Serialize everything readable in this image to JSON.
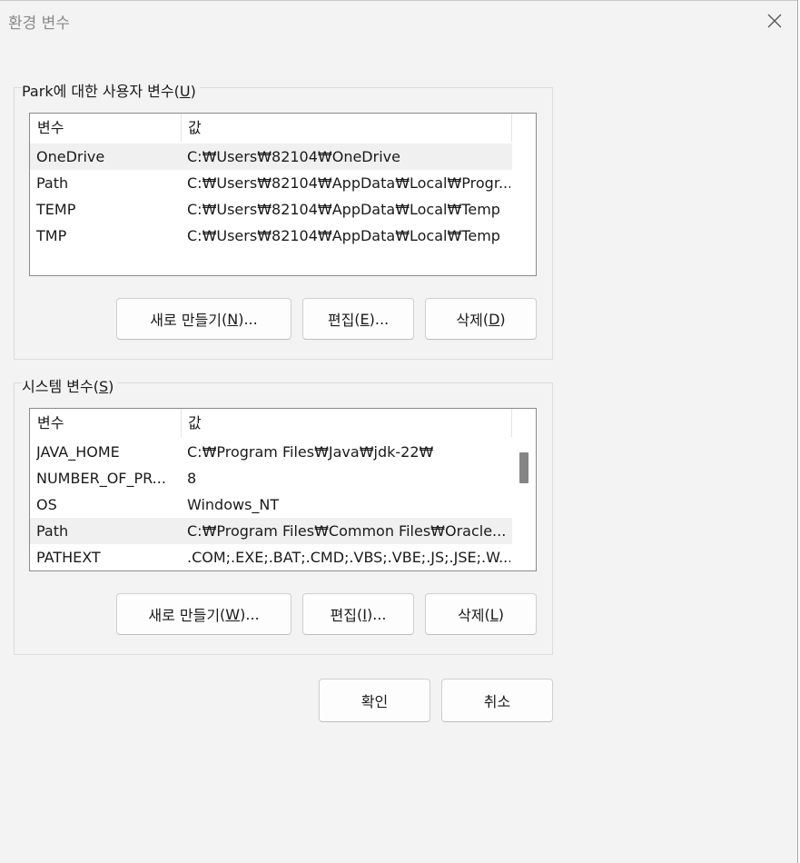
{
  "window": {
    "title": "환경 변수",
    "close_icon": "close-icon"
  },
  "user_vars": {
    "label": "Park에 대한 사용자 변수",
    "label_accel": "U",
    "columns": [
      "변수",
      "값"
    ],
    "rows": [
      {
        "name": "OneDrive",
        "value": "C:₩Users₩82104₩OneDrive",
        "selected": true
      },
      {
        "name": "Path",
        "value": "C:₩Users₩82104₩AppData₩Local₩Progr...",
        "selected": false
      },
      {
        "name": "TEMP",
        "value": "C:₩Users₩82104₩AppData₩Local₩Temp",
        "selected": false
      },
      {
        "name": "TMP",
        "value": "C:₩Users₩82104₩AppData₩Local₩Temp",
        "selected": false
      }
    ],
    "buttons": {
      "new_label": "새로 만들기",
      "new_accel": "N",
      "edit_label": "편집",
      "edit_accel": "E",
      "delete_label": "삭제",
      "delete_accel": "D"
    }
  },
  "system_vars": {
    "label": "시스템 변수",
    "label_accel": "S",
    "columns": [
      "변수",
      "값"
    ],
    "rows": [
      {
        "name": "JAVA_HOME",
        "value": "C:₩Program Files₩Java₩jdk-22₩",
        "selected": false
      },
      {
        "name": "NUMBER_OF_PR...",
        "value": "8",
        "selected": false
      },
      {
        "name": "OS",
        "value": "Windows_NT",
        "selected": false
      },
      {
        "name": "Path",
        "value": "C:₩Program Files₩Common Files₩Oracle...",
        "selected": true
      },
      {
        "name": "PATHEXT",
        "value": ".COM;.EXE;.BAT;.CMD;.VBS;.VBE;.JS;.JSE;.W...",
        "selected": false
      }
    ],
    "buttons": {
      "new_label": "새로 만들기",
      "new_accel": "W",
      "edit_label": "편집",
      "edit_accel": "I",
      "delete_label": "삭제",
      "delete_accel": "L"
    }
  },
  "footer": {
    "ok_label": "확인",
    "cancel_label": "취소"
  },
  "colors": {
    "dialog_bg": "#f3f3f3",
    "selected_row": "#f0f0f0",
    "list_border": "#8a8a8a"
  }
}
